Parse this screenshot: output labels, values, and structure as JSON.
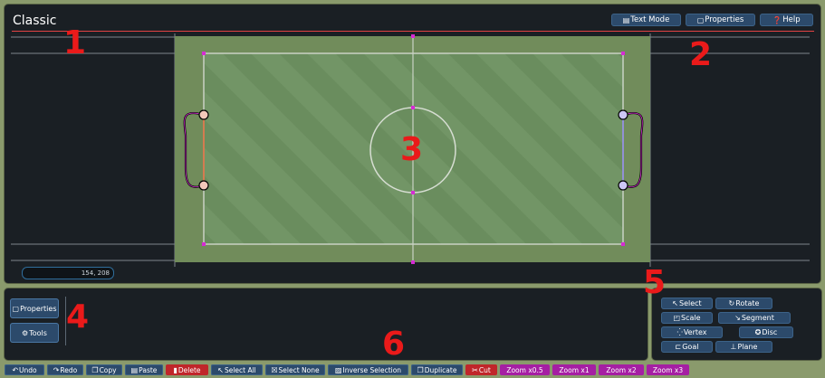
{
  "header": {
    "title": "Classic",
    "buttons": [
      {
        "label": "Text Mode",
        "icon": "save-icon",
        "glyph": "▤"
      },
      {
        "label": "Properties",
        "icon": "properties-icon",
        "glyph": "▢"
      },
      {
        "label": "Help",
        "icon": "help-icon",
        "glyph": "❓"
      }
    ]
  },
  "annotations": [
    "1",
    "2",
    "3",
    "4",
    "5",
    "6"
  ],
  "canvas": {
    "coords": "154, 208"
  },
  "side": {
    "properties_label": "Properties",
    "properties_glyph": "▢",
    "tools_label": "Tools",
    "tools_glyph": "⚙"
  },
  "tools": [
    {
      "label": "Select",
      "glyph": "↖"
    },
    {
      "label": "Rotate",
      "glyph": "↻"
    },
    {
      "label": "Scale",
      "glyph": "◰"
    },
    {
      "label": "Segment",
      "glyph": "↘"
    },
    {
      "label": "Vertex",
      "glyph": "⁛"
    },
    {
      "label": "Disc",
      "glyph": "✪"
    },
    {
      "label": "Goal",
      "glyph": "⊏"
    },
    {
      "label": "Plane",
      "glyph": "⊥"
    }
  ],
  "bottom": [
    {
      "label": "Undo",
      "glyph": "↶",
      "style": "blue"
    },
    {
      "label": "Redo",
      "glyph": "↷",
      "style": "blue"
    },
    {
      "label": "Copy",
      "glyph": "❐",
      "style": "blue"
    },
    {
      "label": "Paste",
      "glyph": "▤",
      "style": "blue"
    },
    {
      "label": "Delete",
      "glyph": "▮",
      "style": "red"
    },
    {
      "label": "Select All",
      "glyph": "↖",
      "style": "blue"
    },
    {
      "label": "Select None",
      "glyph": "☒",
      "style": "blue"
    },
    {
      "label": "Inverse Selection",
      "glyph": "▨",
      "style": "blue"
    },
    {
      "label": "Duplicate",
      "glyph": "❐",
      "style": "blue"
    },
    {
      "label": "Cut",
      "glyph": "✂",
      "style": "red"
    },
    {
      "label": "Zoom x0.5",
      "glyph": "",
      "style": "mag"
    },
    {
      "label": "Zoom x1",
      "glyph": "",
      "style": "mag"
    },
    {
      "label": "Zoom x2",
      "glyph": "",
      "style": "mag"
    },
    {
      "label": "Zoom x3",
      "glyph": "",
      "style": "mag"
    }
  ],
  "colors": {
    "accent_line": "#e24343",
    "button_blue": "#2c4a6b",
    "button_red": "#c0262a",
    "button_magenta": "#a51fa3",
    "red_goal": "#e56a3a",
    "blue_goal": "#8e86e8",
    "vertex": "#d62bd3"
  }
}
